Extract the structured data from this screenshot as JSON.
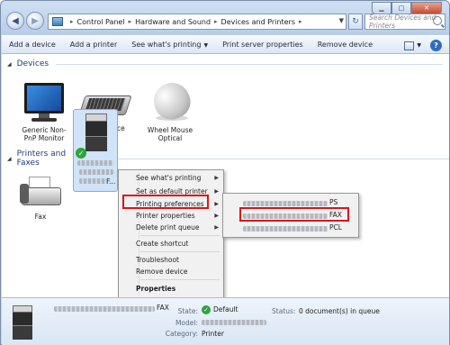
{
  "window": {
    "controls": {
      "minimize": "▁",
      "maximize": "□",
      "close": "✕"
    },
    "back_glyph": "◀",
    "forward_glyph": "▶",
    "refresh_glyph": "↻"
  },
  "address": {
    "crumbs": [
      "Control Panel",
      "Hardware and Sound",
      "Devices and Printers"
    ],
    "separator": "▸"
  },
  "search": {
    "placeholder": "Search Devices and Printers"
  },
  "toolbar": {
    "add_device": "Add a device",
    "add_printer": "Add a printer",
    "see_printing": "See what's printing",
    "print_server": "Print server properties",
    "remove_device": "Remove device",
    "help": "?"
  },
  "groups": {
    "devices": "Devices",
    "printers": "Printers and Faxes"
  },
  "devices": [
    {
      "label": "Generic Non-PnP Monitor",
      "icon": "monitor-icon"
    },
    {
      "label": "USB Device",
      "icon": "keyboard-icon"
    },
    {
      "label": "Wheel Mouse Optical",
      "icon": "mouse-icon"
    }
  ],
  "printers": [
    {
      "label": "Fax",
      "icon": "fax-icon"
    },
    {
      "label_suffix": "F...",
      "icon": "printer-icon",
      "selected": true,
      "default": true
    }
  ],
  "context_menu": [
    {
      "label": "See what's printing",
      "submenu": true
    },
    {
      "label": "Set as default printer",
      "submenu": true
    },
    {
      "label": "Printing preferences",
      "submenu": true
    },
    {
      "label": "Printer properties",
      "submenu": true
    },
    {
      "label": "Delete print queue",
      "submenu": true
    },
    {
      "label": "Create shortcut",
      "submenu": false
    },
    {
      "label": "Troubleshoot",
      "submenu": false
    },
    {
      "label": "Remove device",
      "submenu": false
    },
    {
      "label": "Properties",
      "submenu": false,
      "bold": true
    }
  ],
  "submenu": [
    {
      "label": "PS"
    },
    {
      "label": "FAX"
    },
    {
      "label": "PCL"
    }
  ],
  "details": {
    "name_suffix": "FAX",
    "state_label": "State:",
    "state_value": "Default",
    "model_label": "Model:",
    "category_label": "Category:",
    "category_value": "Printer",
    "status_label": "Status:",
    "status_value": "0 document(s) in queue"
  },
  "colors": {
    "highlight": "#d9141a",
    "selection": "#cfe3f9",
    "group_header": "#1e3d78"
  }
}
